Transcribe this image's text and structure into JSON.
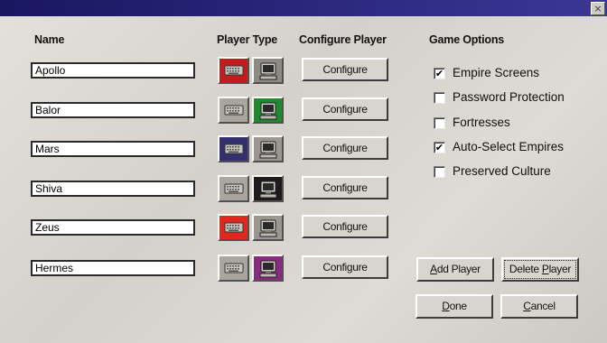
{
  "titlebar": {
    "close_glyph": "×"
  },
  "headers": {
    "name": "Name",
    "player_type": "Player Type",
    "configure_player": "Configure Player",
    "game_options": "Game Options"
  },
  "players": [
    {
      "name": "Apollo",
      "human_color": "#c21d1d",
      "computer_color": "#8d8a84",
      "selected": "human"
    },
    {
      "name": "Balor",
      "human_color": "#aaa69e",
      "computer_color": "#1f8a2e",
      "selected": "computer"
    },
    {
      "name": "Mars",
      "human_color": "#343070",
      "computer_color": "#9a9690",
      "selected": "human"
    },
    {
      "name": "Shiva",
      "human_color": "#aaa69e",
      "computer_color": "#1e1c1a",
      "selected": "computer"
    },
    {
      "name": "Zeus",
      "human_color": "#e0281c",
      "computer_color": "#9a9690",
      "selected": "human"
    },
    {
      "name": "Hermes",
      "human_color": "#aaa69e",
      "computer_color": "#8a2a7e",
      "selected": "computer"
    }
  ],
  "configure_label": "Configure",
  "options": [
    {
      "label": "Empire Screens",
      "checked": true
    },
    {
      "label": "Password Protection",
      "checked": false
    },
    {
      "label": "Fortresses",
      "checked": false
    },
    {
      "label": "Auto-Select Empires",
      "checked": true
    },
    {
      "label": "Preserved Culture",
      "checked": false
    }
  ],
  "check_glyph": "✔",
  "buttons": {
    "add_player": {
      "hotkey": "A",
      "rest": "dd Player"
    },
    "delete_player": {
      "pre": "Delete ",
      "hotkey": "P",
      "rest": "layer"
    },
    "done": {
      "hotkey": "D",
      "rest": "one"
    },
    "cancel": {
      "hotkey": "C",
      "rest": "ancel"
    }
  },
  "icons": {
    "human": "keyboard-icon",
    "computer": "computer-icon"
  }
}
